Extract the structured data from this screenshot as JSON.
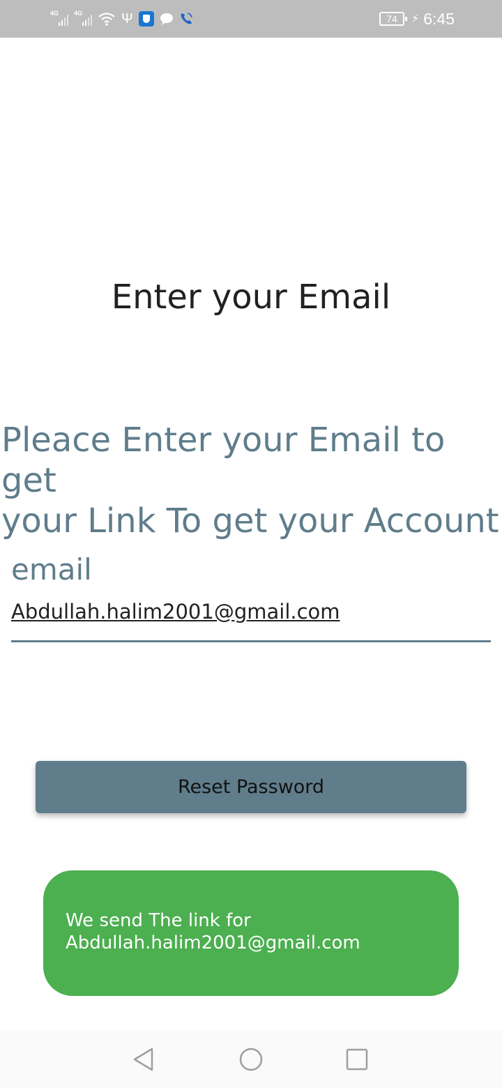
{
  "status_bar": {
    "network_left": "4G",
    "network_right": "4G",
    "battery_level": "74",
    "time": "6:45",
    "icons": [
      "signal-icon",
      "signal-icon",
      "wifi-icon",
      "usb-icon",
      "shield-icon",
      "chat-bubble-icon",
      "phone-call-icon",
      "battery-icon",
      "charging-icon"
    ]
  },
  "page": {
    "title": "Enter your Email",
    "instructions_line1": "Pleace Enter your Email to get",
    "instructions_line2": "your Link To get your Account"
  },
  "form": {
    "email_label": "email",
    "email_value": "Abdullah.halim2001@gmail.com",
    "reset_button_label": "Reset Password"
  },
  "toast": {
    "line1": "We send The link for",
    "line2": "Abdullah.halim2001@gmail.com",
    "color": "#4caf50"
  },
  "nav_bar": {
    "icons": [
      "back-icon",
      "home-icon",
      "recents-icon"
    ]
  },
  "colors": {
    "status_bar": "#bdbdbd",
    "accent": "#607d8b",
    "title_text": "#212121",
    "secondary_text": "#5f7d8b"
  }
}
